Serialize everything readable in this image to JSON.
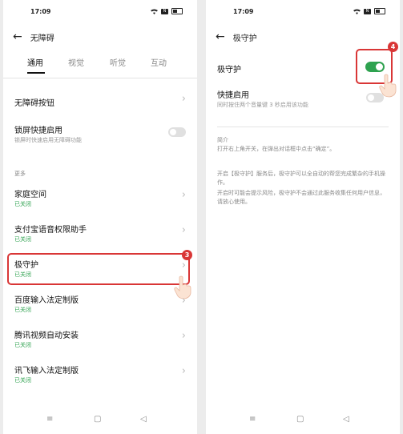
{
  "left": {
    "status_time": "17:09",
    "sim_label": "N",
    "header_title": "无障碍",
    "tabs": [
      "通用",
      "视觉",
      "听觉",
      "互动"
    ],
    "items": [
      {
        "label": "无障碍按钮",
        "sub": ""
      },
      {
        "label": "锁屏快捷启用",
        "sub": "锁屏时快速启用无障碍功能"
      }
    ],
    "section_more": "更多",
    "more_items": [
      {
        "label": "家庭空间",
        "status": "已关闭"
      },
      {
        "label": "支付宝语音权限助手",
        "status": "已关闭"
      },
      {
        "label": "极守护",
        "status": "已关闭"
      },
      {
        "label": "百度输入法定制版",
        "status": "已关闭"
      },
      {
        "label": "腾讯视频自动安装",
        "status": "已关闭"
      },
      {
        "label": "讯飞输入法定制版",
        "status": "已关闭"
      }
    ],
    "step_number": "3"
  },
  "right": {
    "status_time": "17:09",
    "sim_label": "N",
    "header_title": "极守护",
    "main_toggle_label": "极守护",
    "main_toggle_state": "on",
    "shortcut_label": "快捷启用",
    "shortcut_sub": "同时按住两个音量键 3 秒启用该功能",
    "shortcut_state": "off",
    "intro_title": "简介",
    "intro_text": "打开右上角开关，在弹出对话框中点击“确定”。",
    "desc_1": "开启【极守护】服务后，极守护可以全自动的帮您完成繁杂的手机操作。",
    "desc_2": "开启时可能会提示风险，极守护不会通过此服务收集任何用户信息，请放心使用。",
    "step_number": "4"
  },
  "navbar": {
    "menu": "≡",
    "home": "▢",
    "back": "◁"
  },
  "icons": {
    "back": "←",
    "chevron": "›",
    "wifi": "wifi-icon",
    "battery": "battery-icon",
    "hand": "pointing-hand-icon"
  },
  "colors": {
    "highlight": "#d93636",
    "toggle_on": "#2ea24f",
    "status_green": "#2ea24f"
  }
}
